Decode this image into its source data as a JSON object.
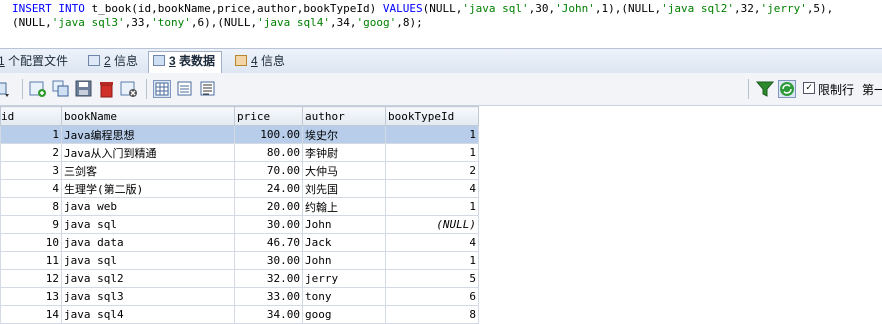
{
  "editor": {
    "line1": {
      "kw1": "INSERT INTO",
      "t1": " t_book(id,bookName,price,author,bookTypeId) ",
      "kw2": "VALUES",
      "t2": "(NULL,",
      "s1": "'java sql'",
      "t3": ",30,",
      "s2": "'John'",
      "t4": ",1),(NULL,",
      "s3": "'java sql2'",
      "t5": ",32,",
      "s4": "'jerry'",
      "t6": ",5),"
    },
    "line2": {
      "t1": "(NULL,",
      "s1": "'java sql3'",
      "t2": ",33,",
      "s2": "'tony'",
      "t3": ",6),(NULL,",
      "s3": "'java sql4'",
      "t4": ",34,",
      "s4": "'goog'",
      "t5": ",8);"
    }
  },
  "tabs": [
    {
      "num": "1",
      "label": " 个配置文件",
      "active": false
    },
    {
      "num": "2",
      "label": " 信息",
      "active": false
    },
    {
      "num": "3",
      "label": " 表数据",
      "active": true
    },
    {
      "num": "4",
      "label": " 信息",
      "active": false
    }
  ],
  "toolbar": {
    "limit_label": "限制行",
    "first_label": "第一"
  },
  "grid": {
    "columns": [
      "id",
      "bookName",
      "price",
      "author",
      "bookTypeId"
    ],
    "rows": [
      {
        "id": "1",
        "bookName": "Java编程思想",
        "price": "100.00",
        "author": "埃史尔",
        "bookTypeId": "1"
      },
      {
        "id": "2",
        "bookName": "Java从入门到精通",
        "price": "80.00",
        "author": "李钟尉",
        "bookTypeId": "1"
      },
      {
        "id": "3",
        "bookName": "三剑客",
        "price": "70.00",
        "author": "大仲马",
        "bookTypeId": "2"
      },
      {
        "id": "4",
        "bookName": "生理学(第二版)",
        "price": "24.00",
        "author": "刘先国",
        "bookTypeId": "4"
      },
      {
        "id": "8",
        "bookName": "java web",
        "price": "20.00",
        "author": "约翰上",
        "bookTypeId": "1"
      },
      {
        "id": "9",
        "bookName": "java sql",
        "price": "30.00",
        "author": "John",
        "bookTypeId": "(NULL)"
      },
      {
        "id": "10",
        "bookName": "java data",
        "price": "46.70",
        "author": "Jack",
        "bookTypeId": "4"
      },
      {
        "id": "11",
        "bookName": "java sql",
        "price": "30.00",
        "author": "John",
        "bookTypeId": "1"
      },
      {
        "id": "12",
        "bookName": "java sql2",
        "price": "32.00",
        "author": "jerry",
        "bookTypeId": "5"
      },
      {
        "id": "13",
        "bookName": "java sql3",
        "price": "33.00",
        "author": "tony",
        "bookTypeId": "6"
      },
      {
        "id": "14",
        "bookName": "java sql4",
        "price": "34.00",
        "author": "goog",
        "bookTypeId": "8"
      }
    ]
  }
}
